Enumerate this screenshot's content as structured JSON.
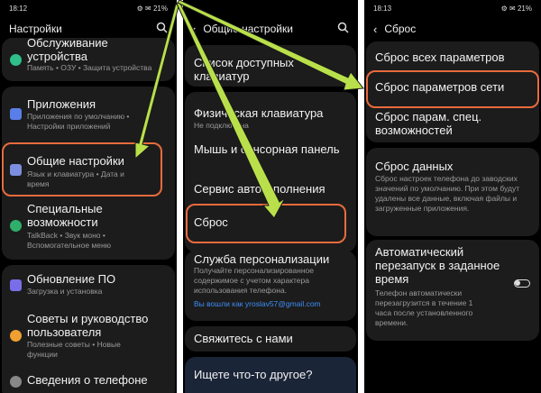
{
  "panel1": {
    "status_time": "18:12",
    "status_icons": "⚙ ✉ 21%",
    "title": "Настройки",
    "items": [
      {
        "title": "Обслуживание устройства",
        "sub": "Память • ОЗУ • Защита устройства"
      },
      {
        "title": "Приложения",
        "sub": "Приложения по умолчанию • Настройки приложений"
      },
      {
        "title": "Общие настройки",
        "sub": "Язык и клавиатура • Дата и время"
      },
      {
        "title": "Специальные возможности",
        "sub": "TalkBack • Звук моно • Вспомогательное меню"
      },
      {
        "title": "Обновление ПО",
        "sub": "Загрузка и установка"
      },
      {
        "title": "Советы и руководство пользователя",
        "sub": "Полезные советы • Новые функции"
      },
      {
        "title": "Сведения о телефоне",
        "sub": ""
      }
    ]
  },
  "panel2": {
    "title": "Общие настройки",
    "items": [
      {
        "title": "Список доступных клавиатур",
        "sub": ""
      },
      {
        "title": "Физическая клавиатура",
        "sub": "Не подключена"
      },
      {
        "title": "Мышь и сенсорная панель",
        "sub": ""
      },
      {
        "title": "Сервис автозаполнения",
        "sub": ""
      },
      {
        "title": "Сброс",
        "sub": ""
      },
      {
        "title": "Служба персонализации",
        "sub": "Получайте персонализированное содержимое с учетом характера использования телефона.",
        "link": "Вы вошли как yroslav57@gmail.com"
      },
      {
        "title": "Свяжитесь с нами",
        "sub": ""
      }
    ],
    "footer": "Ищете что-то другое?"
  },
  "panel3": {
    "status_time": "18:13",
    "status_icons": "⚙ ✉ 21%",
    "title": "Сброс",
    "items": [
      {
        "title": "Сброс всех параметров",
        "sub": ""
      },
      {
        "title": "Сброс параметров сети",
        "sub": ""
      },
      {
        "title": "Сброс парам. спец. возможностей",
        "sub": ""
      },
      {
        "title": "Сброс данных",
        "sub": "Сброс настроек телефона до заводских значений по умолчанию. При этом будут удалены все данные, включая файлы и загруженные приложения."
      },
      {
        "title": "Автоматический перезапуск в заданное время",
        "sub": "Телефон автоматически перезагрузится в течение 1 часа после установленного времени."
      }
    ]
  },
  "colors": {
    "highlight": "#e96b3d",
    "arrow": "#b9e04a",
    "link": "#3e8ef7"
  }
}
